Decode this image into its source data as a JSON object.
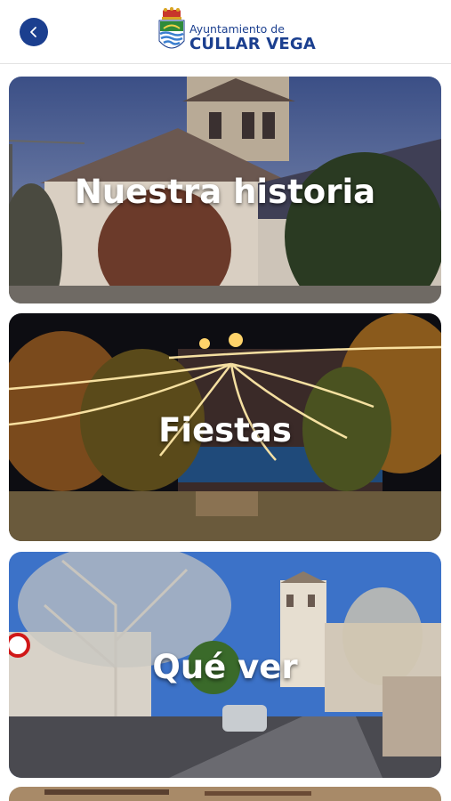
{
  "header": {
    "back_icon": "chevron-left-icon",
    "logo_line1": "Ayuntamiento de",
    "logo_line2": "CÚLLAR VEGA",
    "accent_color": "#1b3f8f"
  },
  "cards": [
    {
      "title": "Nuestra historia"
    },
    {
      "title": "Fiestas"
    },
    {
      "title": "Qué ver"
    }
  ]
}
